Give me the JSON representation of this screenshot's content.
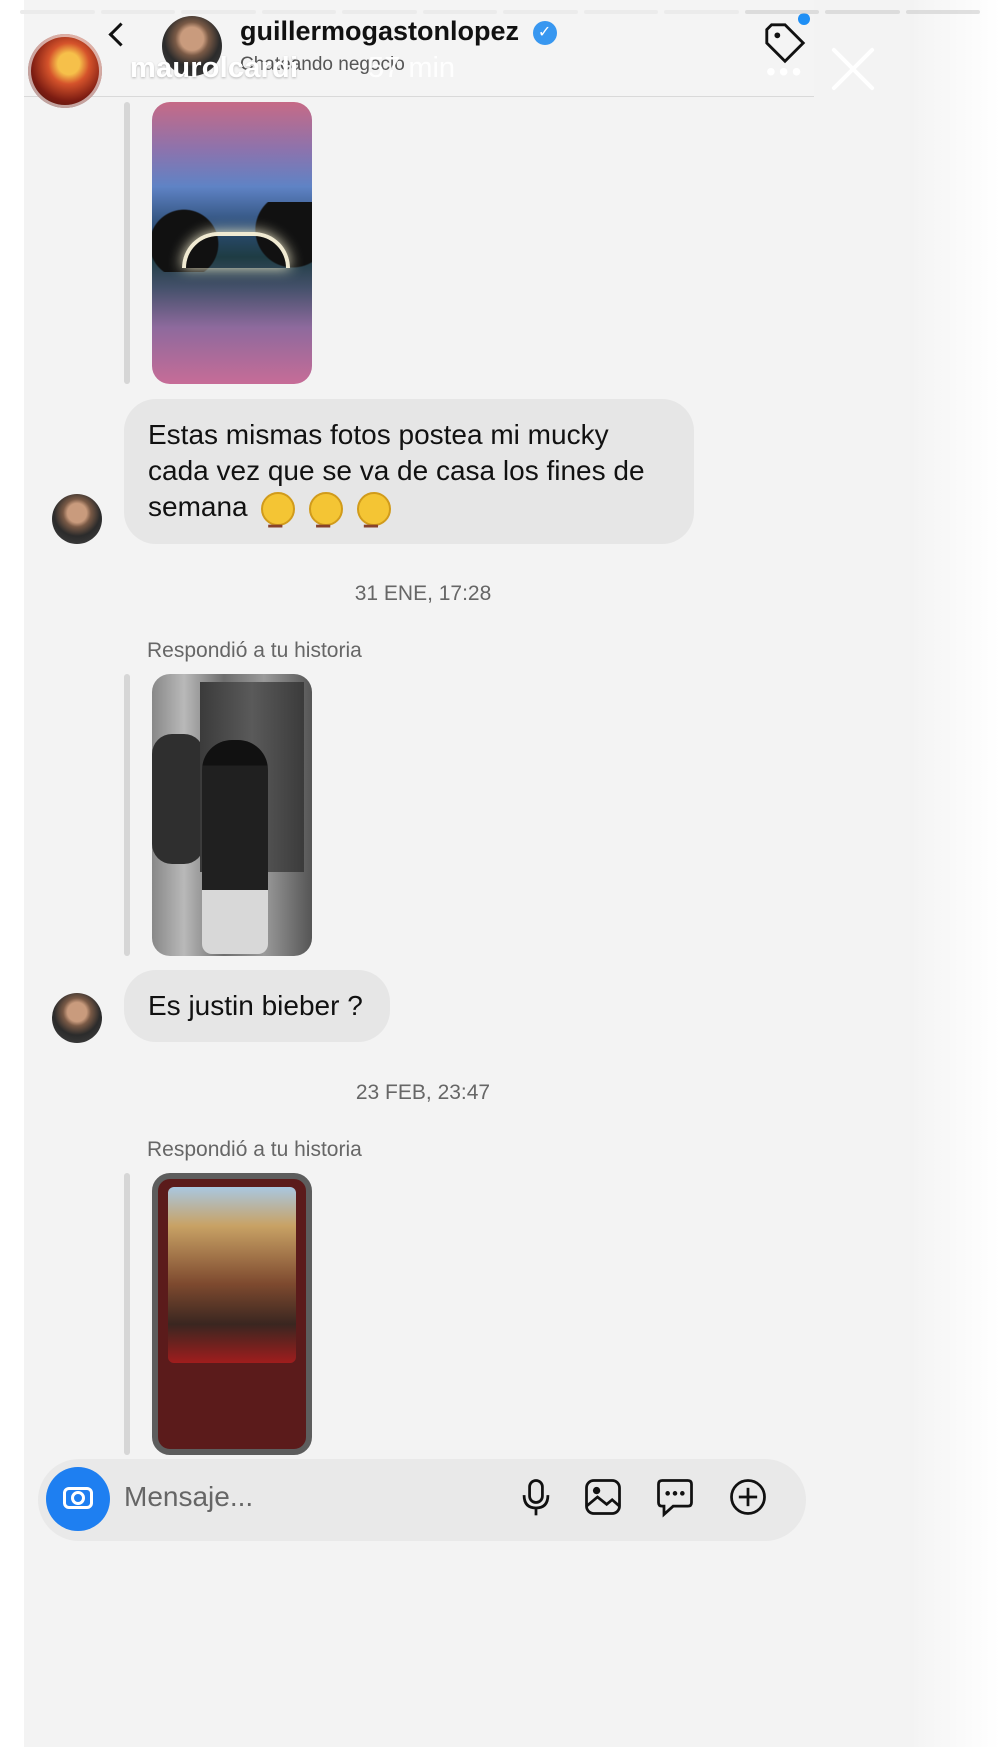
{
  "story": {
    "username": "maurolcardi",
    "time": "57 min",
    "close_label": "Close story"
  },
  "dm": {
    "username": "guillermogastonlopez",
    "subtitle": "Chateando negocio"
  },
  "thread": {
    "messages": [
      {
        "text": "Estas mismas fotos postea mi mucky cada vez que se va de casa los fines de semana"
      },
      {
        "text": "Es justin bieber ?"
      }
    ],
    "timestamps": [
      "31 ENE, 17:28",
      "23 FEB, 23:47"
    ],
    "reply_label": "Respondió a tu historia"
  },
  "composer": {
    "placeholder": "Mensaje..."
  },
  "icons": [
    "camera-icon",
    "microphone-icon",
    "image-icon",
    "sticker-icon",
    "plus-icon",
    "tag-icon",
    "close-icon",
    "verified-icon"
  ]
}
